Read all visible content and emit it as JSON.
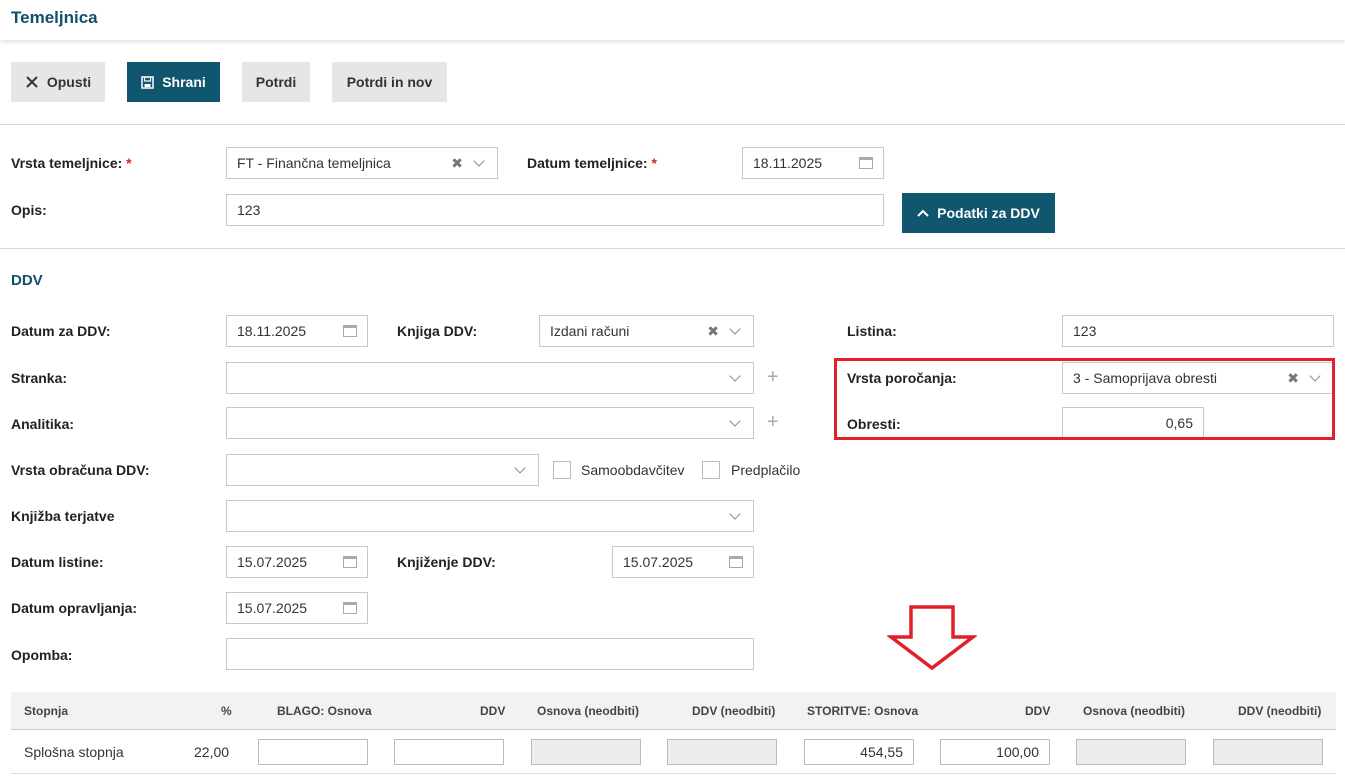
{
  "window": {
    "title": "Temeljnica"
  },
  "toolbar": {
    "cancel_label": "Opusti",
    "save_label": "Shrani",
    "confirm_label": "Potrdi",
    "confirm_new_label": "Potrdi in nov"
  },
  "header_form": {
    "vrsta_label": "Vrsta temeljnice:",
    "vrsta_value": "FT - Finančna temeljnica",
    "datum_label": "Datum temeljnice:",
    "datum_value": "18.11.2025",
    "opis_label": "Opis:",
    "opis_value": "123",
    "ddv_toggle_label": "Podatki za DDV",
    "required_mark": "*"
  },
  "ddv": {
    "section_title": "DDV",
    "datum_za_ddv_label": "Datum za DDV:",
    "datum_za_ddv_value": "18.11.2025",
    "knjiga_label": "Knjiga DDV:",
    "knjiga_value": "Izdani računi",
    "listina_label": "Listina:",
    "listina_value": "123",
    "stranka_label": "Stranka:",
    "stranka_value": "",
    "vrsta_porocanja_label": "Vrsta poročanja:",
    "vrsta_porocanja_value": "3 - Samoprijava obresti",
    "analitika_label": "Analitika:",
    "analitika_value": "",
    "obresti_label": "Obresti:",
    "obresti_value": "0,65",
    "vrsta_obracuna_label": "Vrsta obračuna DDV:",
    "vrsta_obracuna_value": "",
    "samoobdavcitev_label": "Samoobdavčitev",
    "predplacilo_label": "Predplačilo",
    "knjizba_terjatve_label": "Knjižba terjatve",
    "knjizba_terjatve_value": "",
    "datum_listine_label": "Datum listine:",
    "datum_listine_value": "15.07.2025",
    "knjizenje_label": "Knjiženje DDV:",
    "knjizenje_value": "15.07.2025",
    "datum_opravljanja_label": "Datum opravljanja:",
    "datum_opravljanja_value": "15.07.2025",
    "opomba_label": "Opomba:",
    "opomba_value": ""
  },
  "table": {
    "headers": [
      "Stopnja",
      "%",
      "BLAGO: Osnova",
      "DDV",
      "Osnova (neodbiti)",
      "DDV (neodbiti)",
      "STORITVE: Osnova",
      "DDV",
      "Osnova (neodbiti)",
      "DDV (neodbiti)"
    ],
    "rows": [
      {
        "stopnja": "Splošna stopnja",
        "pct": "22,00",
        "blago_osnova": "",
        "blago_ddv": "",
        "blago_osnova_neodb": "",
        "blago_ddv_neodb": "",
        "storitve_osnova": "454,55",
        "storitve_ddv": "100,00",
        "storitve_osnova_neodb": "",
        "storitve_ddv_neodb": ""
      }
    ]
  },
  "colors": {
    "primary": "#11566f",
    "title": "#12506e",
    "highlight": "#e0202a"
  }
}
